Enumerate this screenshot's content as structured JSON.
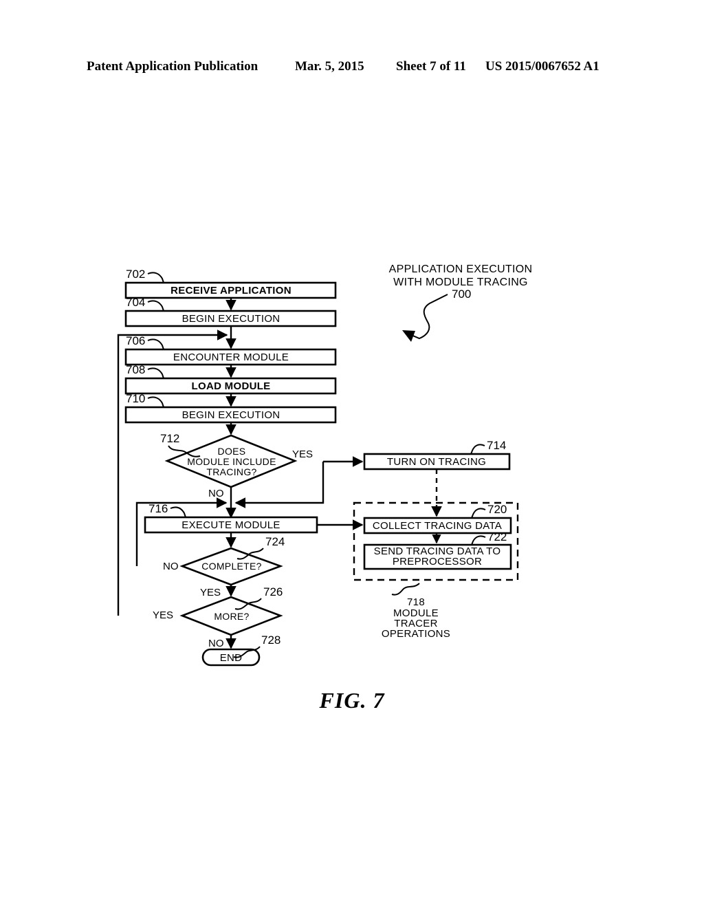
{
  "header": {
    "publication": "Patent Application Publication",
    "date": "Mar. 5, 2015",
    "sheet": "Sheet 7 of 11",
    "number": "US 2015/0067652 A1"
  },
  "figure": {
    "caption": "FIG. 7",
    "title_line1": "APPLICATION EXECUTION",
    "title_line2": "WITH MODULE TRACING",
    "title_ref": "700"
  },
  "nodes": {
    "n702": {
      "ref": "702",
      "label": "RECEIVE APPLICATION"
    },
    "n704": {
      "ref": "704",
      "label": "BEGIN EXECUTION"
    },
    "n706": {
      "ref": "706",
      "label": "ENCOUNTER MODULE"
    },
    "n708": {
      "ref": "708",
      "label": "LOAD MODULE"
    },
    "n710": {
      "ref": "710",
      "label": "BEGIN EXECUTION"
    },
    "n712": {
      "ref": "712",
      "label_line1": "DOES",
      "label_line2": "MODULE INCLUDE",
      "label_line3": "TRACING?"
    },
    "n714": {
      "ref": "714",
      "label": "TURN ON TRACING"
    },
    "n716": {
      "ref": "716",
      "label": "EXECUTE MODULE"
    },
    "n720": {
      "ref": "720",
      "label": "COLLECT TRACING DATA"
    },
    "n722": {
      "ref": "722",
      "label_line1": "SEND TRACING DATA TO",
      "label_line2": "PREPROCESSOR"
    },
    "n724": {
      "ref": "724",
      "label": "COMPLETE?"
    },
    "n726": {
      "ref": "726",
      "label": "MORE?"
    },
    "n728": {
      "ref": "728",
      "label": "END"
    }
  },
  "group": {
    "ref": "718",
    "line1": "MODULE",
    "line2": "TRACER",
    "line3": "OPERATIONS"
  },
  "edge_labels": {
    "yes_712": "YES",
    "no_712": "NO",
    "no_724": "NO",
    "yes_724": "YES",
    "yes_726": "YES",
    "no_726": "NO"
  }
}
